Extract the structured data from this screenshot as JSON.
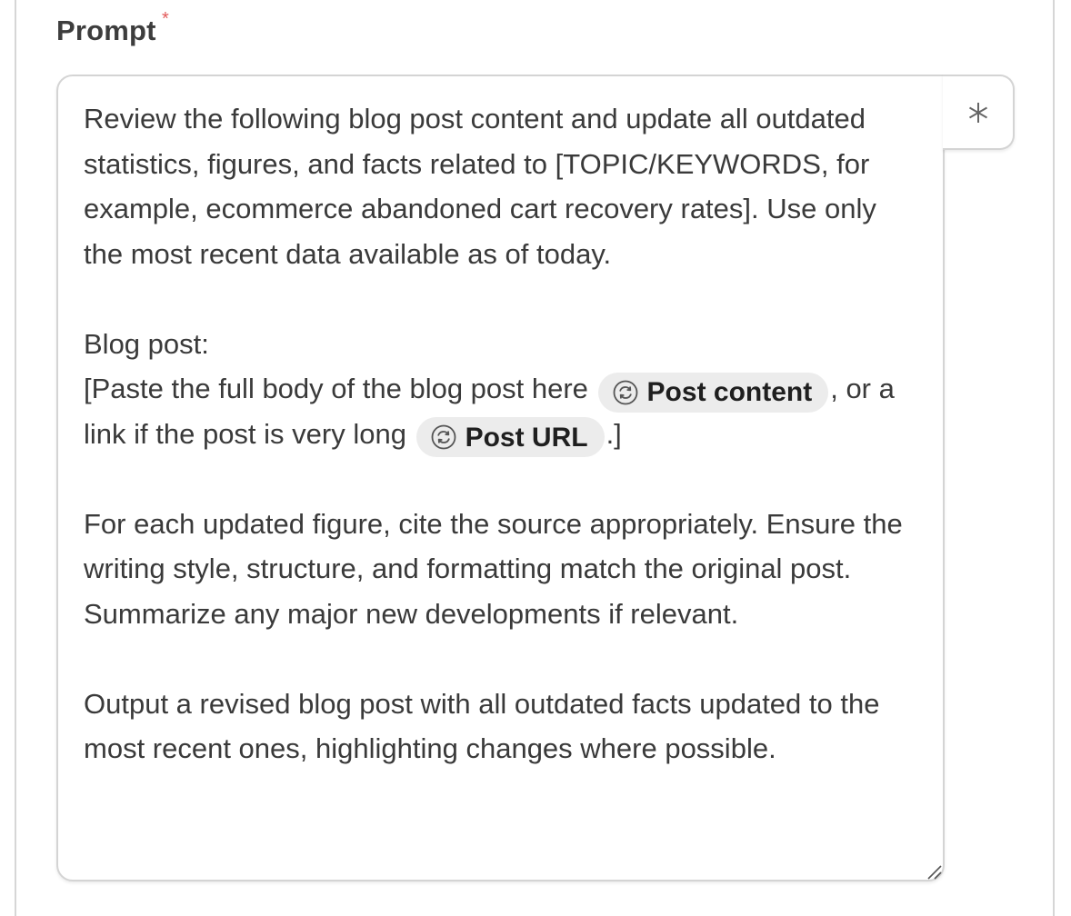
{
  "field": {
    "label": "Prompt",
    "required_mark": "*"
  },
  "prompt": {
    "paragraph_1": "Review the following blog post content and update all outdated statistics, figures, and facts related to [TOPIC/KEYWORDS, for example, ecommerce abandoned cart recovery rates]. Use only the most recent data available as of today.",
    "blog_heading": "Blog post:",
    "line_a_before": "[Paste the full body of the blog post here ",
    "chip_1_label": "Post content",
    "line_a_after": ", or a link if the post is very long ",
    "chip_2_label": "Post URL",
    "line_b_after": ".]",
    "paragraph_3": "For each updated figure, cite the source appropriately. Ensure the writing style, structure, and formatting match the original post. Summarize any major new developments if relevant.",
    "paragraph_4": "Output a revised blog post with all outdated facts updated to the most recent ones, highlighting changes where possible."
  },
  "icons": {
    "chip_icon": "variable-sync-icon",
    "side_button_icon": "asterisk-icon",
    "resize_icon": "resize-handle-icon"
  },
  "colors": {
    "required": "#e25a5a",
    "chip_bg": "#ececec",
    "border": "#d4d4d4"
  }
}
